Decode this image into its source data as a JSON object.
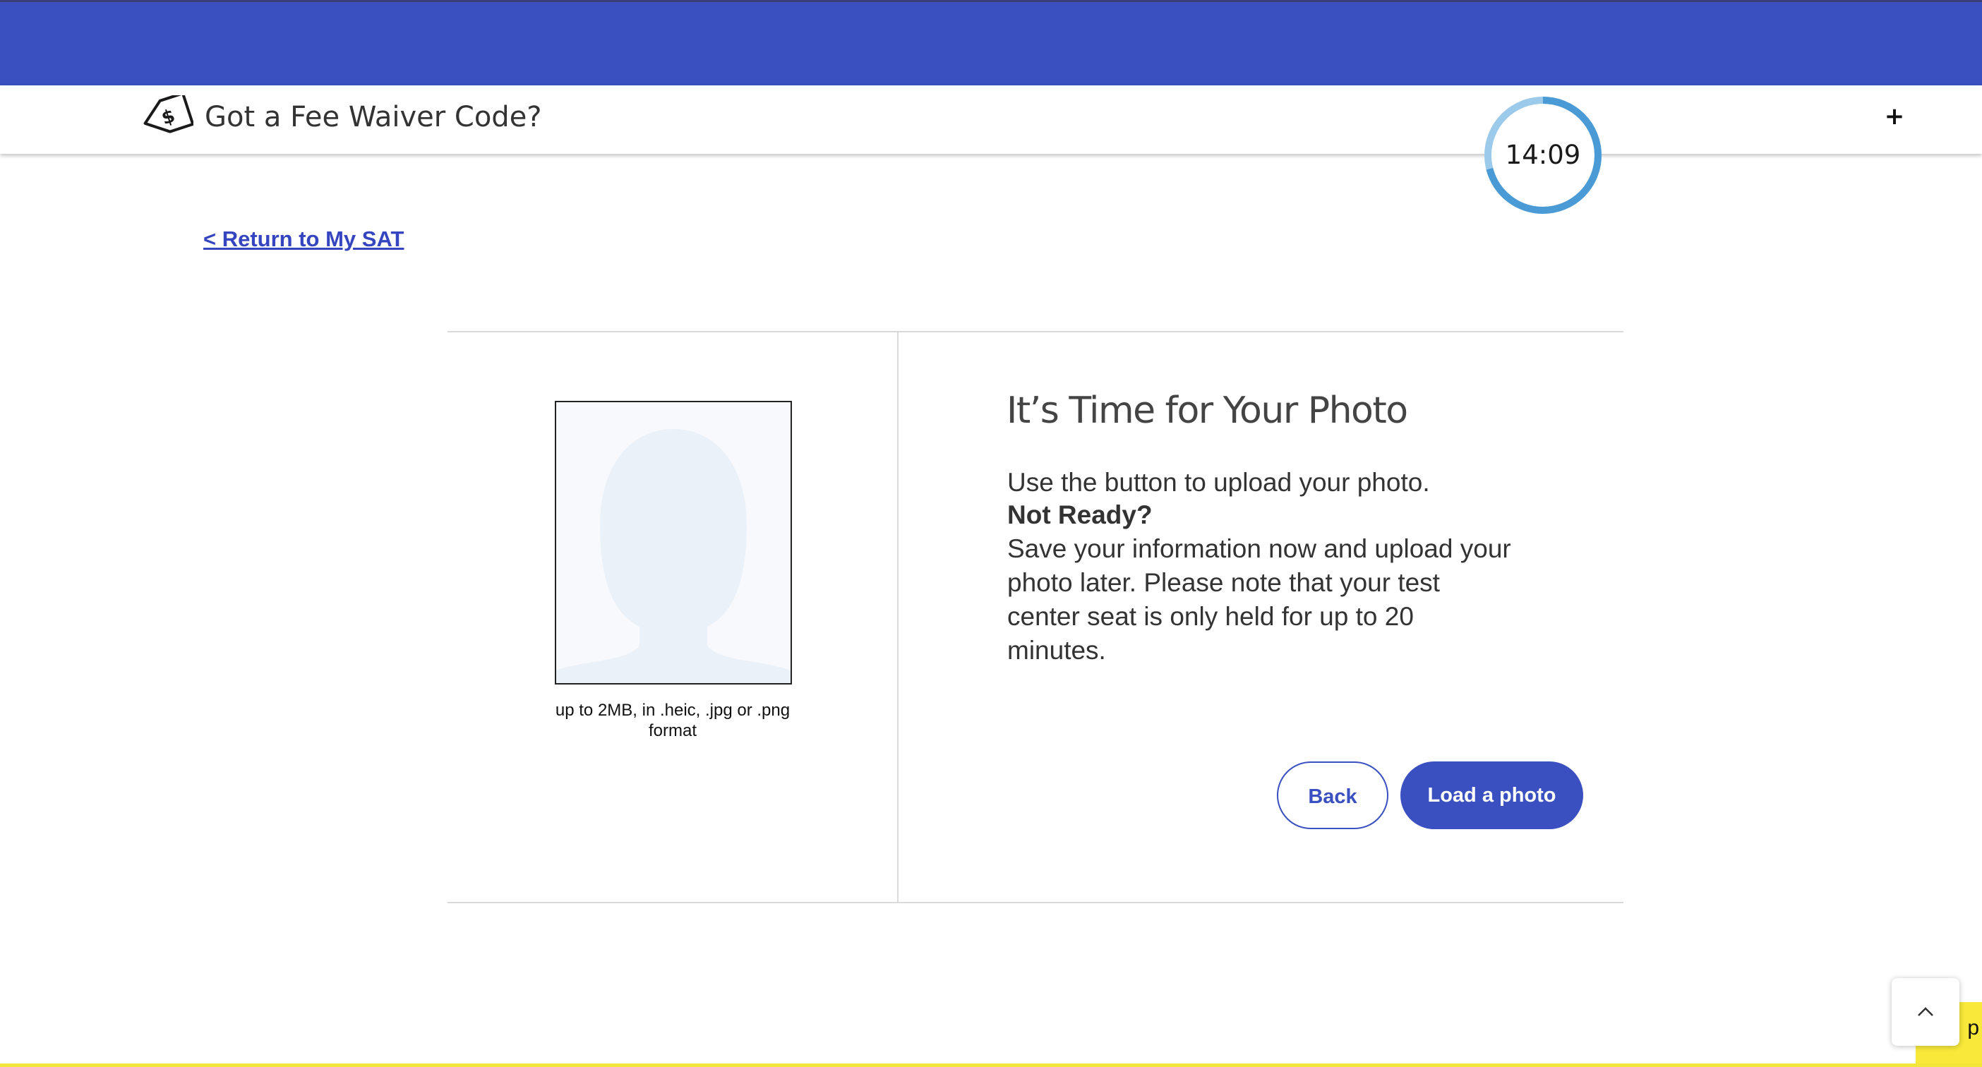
{
  "colors": {
    "brand_blue": "#3a4fc0",
    "link_blue": "#3545bf",
    "accent_yellow": "#f2e63a",
    "timer_ring": "#7bb8e3"
  },
  "fee_waiver": {
    "icon": "price-tag-dollar-icon",
    "label": "Got a Fee Waiver Code?",
    "toggle_icon": "plus-icon",
    "toggle_label": "+"
  },
  "timer": {
    "time": "14:09",
    "remaining_fraction": 0.71
  },
  "nav": {
    "return_link": "< Return to My SAT"
  },
  "photo": {
    "placeholder_icon": "person-silhouette-icon",
    "caption": "up to 2MB, in .heic, .jpg or .png format"
  },
  "content": {
    "heading": "It’s Time for Your Photo",
    "line1": "Use the button to upload your photo.",
    "not_ready": "Not Ready?",
    "line2": "Save your information now and upload your photo later. Please note that your test center seat is only held for up to 20 minutes."
  },
  "buttons": {
    "back": "Back",
    "load": "Load a photo"
  },
  "footer": {
    "scroll_icon": "chevron-up-icon",
    "help_tab_text": "p"
  }
}
